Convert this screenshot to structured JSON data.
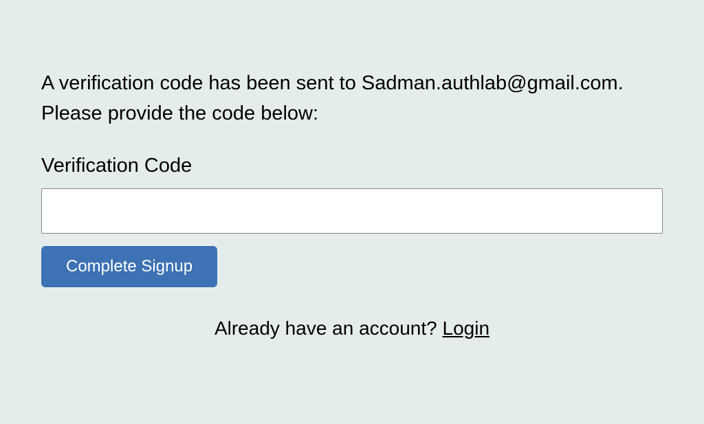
{
  "verification": {
    "instruction_line1": "A verification code has been sent to Sadman.authlab@gmail.com.",
    "instruction_line2": "Please provide the code below:",
    "label": "Verification Code",
    "input_value": "",
    "submit_label": "Complete Signup"
  },
  "footer": {
    "text": "Already have an account? ",
    "login_label": "Login"
  }
}
